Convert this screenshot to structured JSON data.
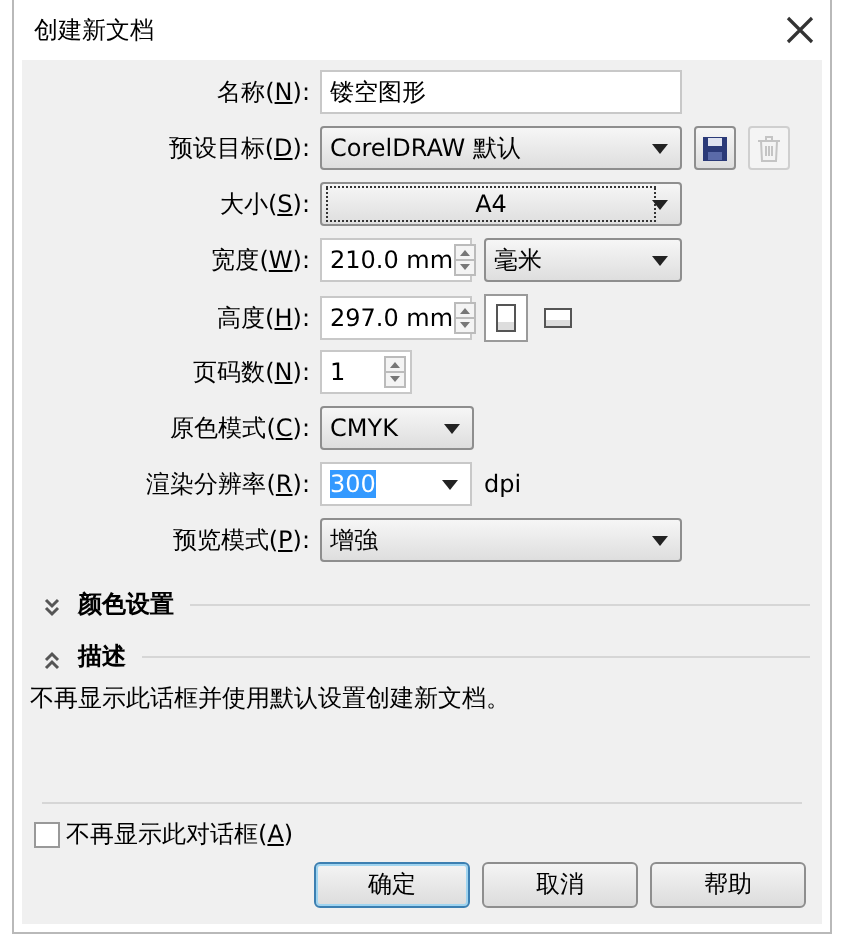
{
  "window": {
    "title": "创建新文档"
  },
  "fields": [
    {
      "kind": "text",
      "label": [
        "名称(",
        "N",
        "):"
      ],
      "value": "镂空图形"
    },
    {
      "kind": "preset",
      "label": [
        "预设目标(",
        "D",
        "):"
      ],
      "value": "CorelDRAW 默认",
      "delete_disabled": true
    },
    {
      "kind": "dropdown",
      "label": [
        "大小(",
        "S",
        "):"
      ],
      "value": "A4",
      "focused": true
    },
    {
      "kind": "spin_unit",
      "label": [
        "宽度(",
        "W",
        "):"
      ],
      "value": "210.0 mm",
      "unit": "毫米"
    },
    {
      "kind": "spin_orient",
      "label": [
        "高度(",
        "H",
        "):"
      ],
      "value": "297.0 mm",
      "orientations": [
        {
          "kind": "portrait",
          "selected": true
        },
        {
          "kind": "landscape",
          "selected": false
        }
      ]
    },
    {
      "kind": "spin",
      "label": [
        "页码数(",
        "N",
        "):"
      ],
      "value": "1"
    },
    {
      "kind": "short_dropdown",
      "label": [
        "原色模式(",
        "C",
        "):"
      ],
      "value": "CMYK"
    },
    {
      "kind": "combo",
      "label": [
        "渲染分辨率(",
        "R",
        "):"
      ],
      "value": "300",
      "value_selected": true,
      "unit": "dpi"
    },
    {
      "kind": "dropdown",
      "label": [
        "预览模式(",
        "P",
        "):"
      ],
      "value": "增強",
      "focused": false
    }
  ],
  "sections": [
    {
      "title": "颜色设置",
      "expanded": false
    },
    {
      "title": "描述",
      "expanded": true,
      "text": "不再显示此话框并使用默认设置创建新文档。"
    }
  ],
  "dont_show": {
    "label": [
      "不再显示此对话框(",
      "A",
      ")"
    ],
    "checked": false
  },
  "buttons": [
    {
      "label": "确定",
      "default": true
    },
    {
      "label": "取消",
      "default": false
    },
    {
      "label": "帮助",
      "default": false
    }
  ]
}
